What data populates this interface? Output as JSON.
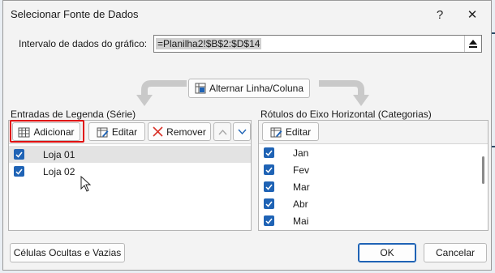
{
  "dialog": {
    "title": "Selecionar Fonte de Dados",
    "help_label": "?",
    "close_label": "✕"
  },
  "range": {
    "label": "Intervalo de dados do gráfico:",
    "value": "=Planilha2!$B$2:$D$14"
  },
  "switch_button": {
    "label": "Alternar Linha/Coluna"
  },
  "legend": {
    "header": "Entradas de Legenda (Série)",
    "add_label": "Adicionar",
    "edit_label": "Editar",
    "remove_label": "Remover",
    "items": [
      {
        "label": "Loja 01",
        "checked": true,
        "selected": true
      },
      {
        "label": "Loja 02",
        "checked": true,
        "selected": false
      }
    ]
  },
  "axis": {
    "header": "Rótulos do Eixo Horizontal (Categorias)",
    "edit_label": "Editar",
    "items": [
      {
        "label": "Jan",
        "checked": true
      },
      {
        "label": "Fev",
        "checked": true
      },
      {
        "label": "Mar",
        "checked": true
      },
      {
        "label": "Abr",
        "checked": true
      },
      {
        "label": "Mai",
        "checked": true
      }
    ]
  },
  "footer": {
    "hidden_cells_label": "Células Ocultas e Vazias",
    "ok_label": "OK",
    "cancel_label": "Cancelar"
  },
  "colors": {
    "accent": "#1f63b5",
    "highlight": "#e01010"
  }
}
